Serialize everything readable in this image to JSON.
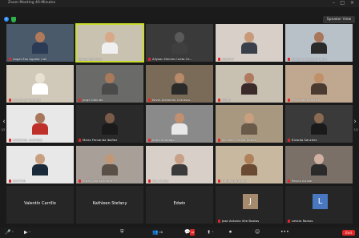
{
  "window": {
    "title": "Zoom Meeting 40-Minutes",
    "controls": [
      "–",
      "□",
      "×"
    ]
  },
  "header": {
    "view_label": "Speaker View"
  },
  "nav": {
    "prev": "‹",
    "next": "›",
    "page_left": "1/2",
    "page_right": "1/2"
  },
  "participants": [
    {
      "name": "Angel Zon Aguilar Coli",
      "kind": "video",
      "muted": true,
      "bg": "#4a5a6a",
      "skin": "#b07a5a",
      "shirt": "#2b3a55"
    },
    {
      "name": "Carlos Sánchez",
      "kind": "video",
      "muted": false,
      "active": true,
      "bg": "#c9c2b0",
      "skin": "#d8a888",
      "shirt": "#f0f0f0"
    },
    {
      "name": "Allyson Dennis Cueto Ce...",
      "kind": "video",
      "muted": true,
      "bg": "#3a3a3a",
      "skin": "#5a5a5a",
      "shirt": "#3f3f3f"
    },
    {
      "name": "JESSICA",
      "kind": "video",
      "muted": true,
      "bg": "#d8d0c8",
      "skin": "#c99a7a",
      "shirt": "#3a3f4a"
    },
    {
      "name": "Angel S. Isacedo Mordi",
      "kind": "video",
      "muted": true,
      "bg": "#b8c0c8",
      "skin": "#a8765a",
      "shirt": "#2a2a2a"
    },
    {
      "name": "Fernando Vazquez",
      "kind": "video",
      "muted": true,
      "bg": "#d0c8b8",
      "skin": "#e8e0d0",
      "shirt": "#ffffff"
    },
    {
      "name": "Jorge Galindo",
      "kind": "video",
      "muted": true,
      "bg": "#6a6a68",
      "skin": "#a87a5a",
      "shirt": "#4a4a4a"
    },
    {
      "name": "Kevin Alejandro Carrasco",
      "kind": "video",
      "muted": true,
      "bg": "#7a6a58",
      "skin": "#b88a6a",
      "shirt": "#2a2a2a"
    },
    {
      "name": "Aylen",
      "kind": "video",
      "muted": true,
      "bg": "#c8c0b0",
      "skin": "#b07a60",
      "shirt": "#3a2a2a"
    },
    {
      "name": "Fernando Sánchez",
      "kind": "video",
      "muted": true,
      "bg": "#c0a890",
      "skin": "#c0906a",
      "shirt": "#4a3a30"
    },
    {
      "name": "EZEQUIEL ALVAREZ",
      "kind": "video",
      "muted": true,
      "bg": "#e8e8e8",
      "skin": "#a8765a",
      "shirt": "#c0302a"
    },
    {
      "name": "Maria Fernanda Ibañez",
      "kind": "video",
      "muted": true,
      "bg": "#2a2a2a",
      "skin": "#7a5a48",
      "shirt": "#1a1a1a"
    },
    {
      "name": "Karla Santiago",
      "kind": "video",
      "muted": true,
      "bg": "#8a8a8a",
      "skin": "#c09070",
      "shirt": "#e8e8e8"
    },
    {
      "name": "Michelle Cecilia Carbia",
      "kind": "video",
      "muted": true,
      "bg": "#a89880",
      "skin": "#c8a080",
      "shirt": "#6a5a4a"
    },
    {
      "name": "Ricardo Sanchez",
      "kind": "video",
      "muted": true,
      "bg": "#3a3a3a",
      "skin": "#8a6a50",
      "shirt": "#1a1a1a"
    },
    {
      "name": "HECTOR",
      "kind": "video",
      "muted": true,
      "bg": "#e8e8e8",
      "skin": "#c8a080",
      "shirt": "#1a2a3a"
    },
    {
      "name": "Eisley Alonso Ibarra",
      "kind": "video",
      "muted": true,
      "bg": "#a8a098",
      "skin": "#c09878",
      "shirt": "#5a5048"
    },
    {
      "name": "Zoe Avalos",
      "kind": "video",
      "muted": true,
      "bg": "#d8d0c8",
      "skin": "#c8a088",
      "shirt": "#3a3a3a"
    },
    {
      "name": "Daniel Barragan",
      "kind": "video",
      "muted": true,
      "bg": "#c8b8a0",
      "skin": "#b0805a",
      "shirt": "#6a4a30"
    },
    {
      "name": "Reyna Alcivar",
      "kind": "video",
      "muted": true,
      "bg": "#7a7068",
      "skin": "#d0b0a0",
      "shirt": "#2a2a2a"
    },
    {
      "name": "Valentín Carrillo",
      "kind": "name",
      "muted": true
    },
    {
      "name": "Kathleen Stefany",
      "kind": "name",
      "muted": true
    },
    {
      "name": "Edwin",
      "kind": "name",
      "muted": true
    },
    {
      "name": "Jose Antonio Vite Bustos",
      "kind": "letter",
      "letter": "J",
      "color": "#a58a6e",
      "muted": true
    },
    {
      "name": "Leticia Ramos",
      "kind": "letter",
      "letter": "L",
      "color": "#4a78c0",
      "muted": true
    }
  ],
  "toolbar": {
    "items": [
      {
        "id": "mute",
        "icon": "🎤",
        "label": "^"
      },
      {
        "id": "video",
        "icon": "▶",
        "label": "^"
      },
      {
        "id": "security",
        "icon": "⛨",
        "label": ""
      },
      {
        "id": "participants",
        "icon": "👥",
        "label": "26"
      },
      {
        "id": "chat",
        "icon": "💬",
        "label": ""
      },
      {
        "id": "share",
        "icon": "⬆",
        "label": "^"
      },
      {
        "id": "record",
        "icon": "⏺",
        "label": ""
      },
      {
        "id": "reactions",
        "icon": "☺",
        "label": ""
      },
      {
        "id": "more",
        "icon": "•••",
        "label": ""
      }
    ],
    "chat_badge": "36",
    "end_label": "End"
  }
}
